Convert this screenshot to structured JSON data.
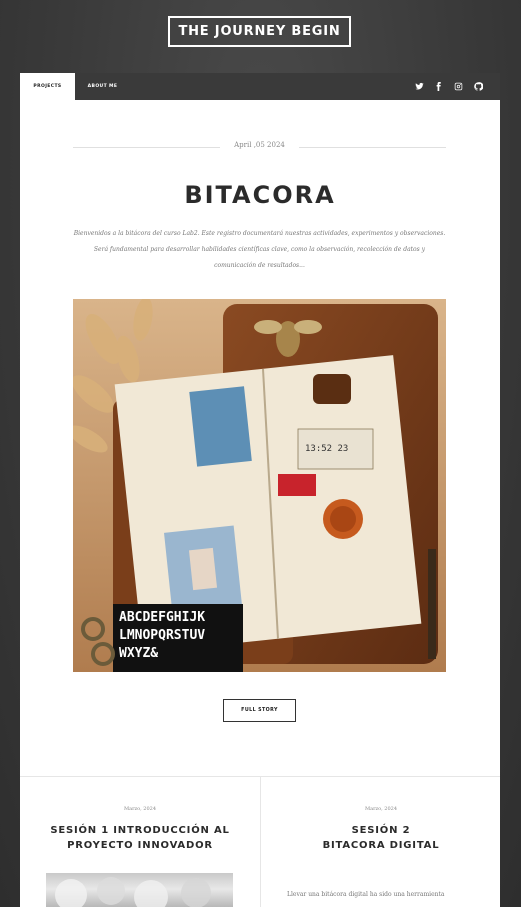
{
  "header": {
    "title": "THE JOURNEY BEGIN"
  },
  "nav": {
    "tabs": [
      {
        "label": "PROJECTS",
        "active": true
      },
      {
        "label": "ABOUT ME",
        "active": false
      }
    ],
    "social_icons": [
      "twitter-icon",
      "facebook-icon",
      "instagram-icon",
      "github-icon"
    ]
  },
  "post": {
    "date": "April ,05 2024",
    "title": "BITACORA",
    "excerpt": "Bienvenidos a la bitácora del curso Lab2. Este registro documentará nuestras actividades, experimentos y observaciones. Será fundamental para desarrollar habilidades científicas clave, como la observación, recolección de datos y comunicación de resultados...",
    "button": "FULL STORY"
  },
  "sessions": [
    {
      "date": "Marzo, 2024",
      "title_line1": "SESIÓN 1 INTRODUCCIÓN AL",
      "title_line2": "PROYECTO INNOVADOR"
    },
    {
      "date": "Marzo, 2024",
      "title_line1": "SESIÓN 2",
      "title_line2": "BITACORA DIGITAL",
      "text": "Llevar una bitácora digital ha sido una herramienta"
    }
  ],
  "colors": {
    "background": "#3a3a3a",
    "nav": "#3a3a3a",
    "card": "#ffffff"
  }
}
